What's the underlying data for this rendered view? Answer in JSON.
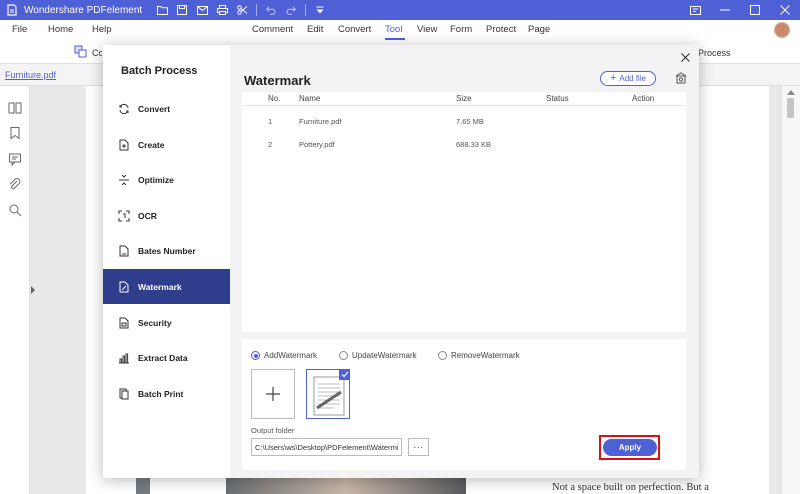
{
  "app": {
    "title": "Wondershare PDFelement",
    "brand_color": "#4f5fd6"
  },
  "menu": {
    "left": [
      "File",
      "Home",
      "Help"
    ],
    "center": [
      "Comment",
      "Edit",
      "Convert",
      "Tool",
      "View",
      "Form",
      "Protect",
      "Page"
    ],
    "active": "Tool"
  },
  "ribbon": {
    "partial_left": "Co",
    "partial_right": "Process"
  },
  "document": {
    "tab_name": "Furniture.pdf",
    "page_text": "Not a space built on perfection. But a"
  },
  "dialog": {
    "nav_title": "Batch Process",
    "nav_items": [
      {
        "label": "Convert",
        "icon": "convert-icon"
      },
      {
        "label": "Create",
        "icon": "create-icon"
      },
      {
        "label": "Optimize",
        "icon": "optimize-icon"
      },
      {
        "label": "OCR",
        "icon": "ocr-icon"
      },
      {
        "label": "Bates Number",
        "icon": "bates-number-icon"
      },
      {
        "label": "Watermark",
        "icon": "watermark-icon"
      },
      {
        "label": "Security",
        "icon": "security-icon"
      },
      {
        "label": "Extract Data",
        "icon": "extract-data-icon"
      },
      {
        "label": "Batch Print",
        "icon": "batch-print-icon"
      }
    ],
    "active_nav": "Watermark",
    "title": "Watermark",
    "add_file_label": "Add file",
    "table": {
      "headers": [
        "No.",
        "Name",
        "Size",
        "Status",
        "Action"
      ],
      "rows": [
        {
          "no": "1",
          "name": "Furniture.pdf",
          "size": "7.65 MB",
          "status": "",
          "action": ""
        },
        {
          "no": "2",
          "name": "Pottery.pdf",
          "size": "688.33 KB",
          "status": "",
          "action": ""
        }
      ]
    },
    "options": {
      "radios": [
        "AddWatermark",
        "UpdateWatermark",
        "RemoveWatermark"
      ],
      "selected": "AddWatermark",
      "output_label": "Output folder",
      "output_value": "C:\\Users\\ws\\Desktop\\PDFelement\\Watermi",
      "browse_label": "···",
      "apply_label": "Apply",
      "highlight_color": "#d90e17"
    }
  }
}
